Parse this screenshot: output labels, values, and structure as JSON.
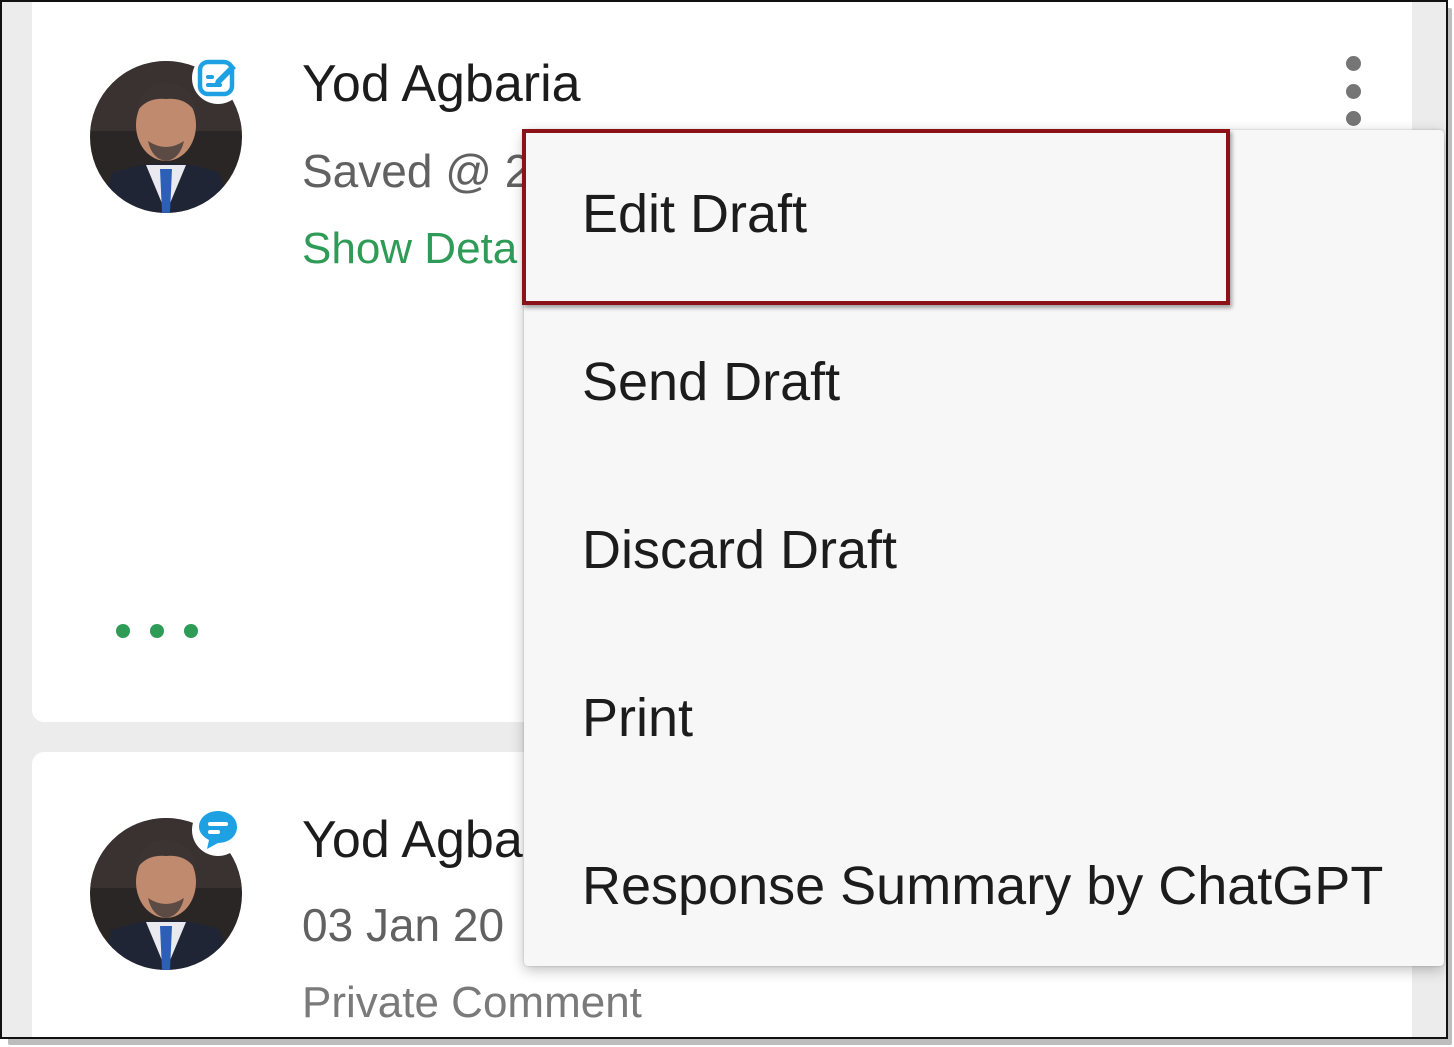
{
  "cards": [
    {
      "sender_name": "Yod Agbaria",
      "meta_text": "Saved @ 2",
      "details_link": "Show Deta",
      "badge_icon": "edit-draft-icon",
      "badge_color": "#1da1e2",
      "more_icon": "more-horizontal-icon"
    },
    {
      "sender_name": "Yod Agba",
      "meta_text": "03 Jan 20",
      "comment_label": "Private Comment",
      "badge_icon": "chat-bubble-icon",
      "badge_color": "#1da1e2"
    }
  ],
  "menu": {
    "items": [
      {
        "label": "Edit Draft",
        "highlighted": true
      },
      {
        "label": "Send Draft"
      },
      {
        "label": "Discard Draft"
      },
      {
        "label": "Print"
      },
      {
        "label": "Response Summary by ChatGPT"
      }
    ]
  },
  "colors": {
    "accent_green": "#2e9b57",
    "highlight_border": "#8b1219",
    "badge_blue": "#1da1e2"
  }
}
